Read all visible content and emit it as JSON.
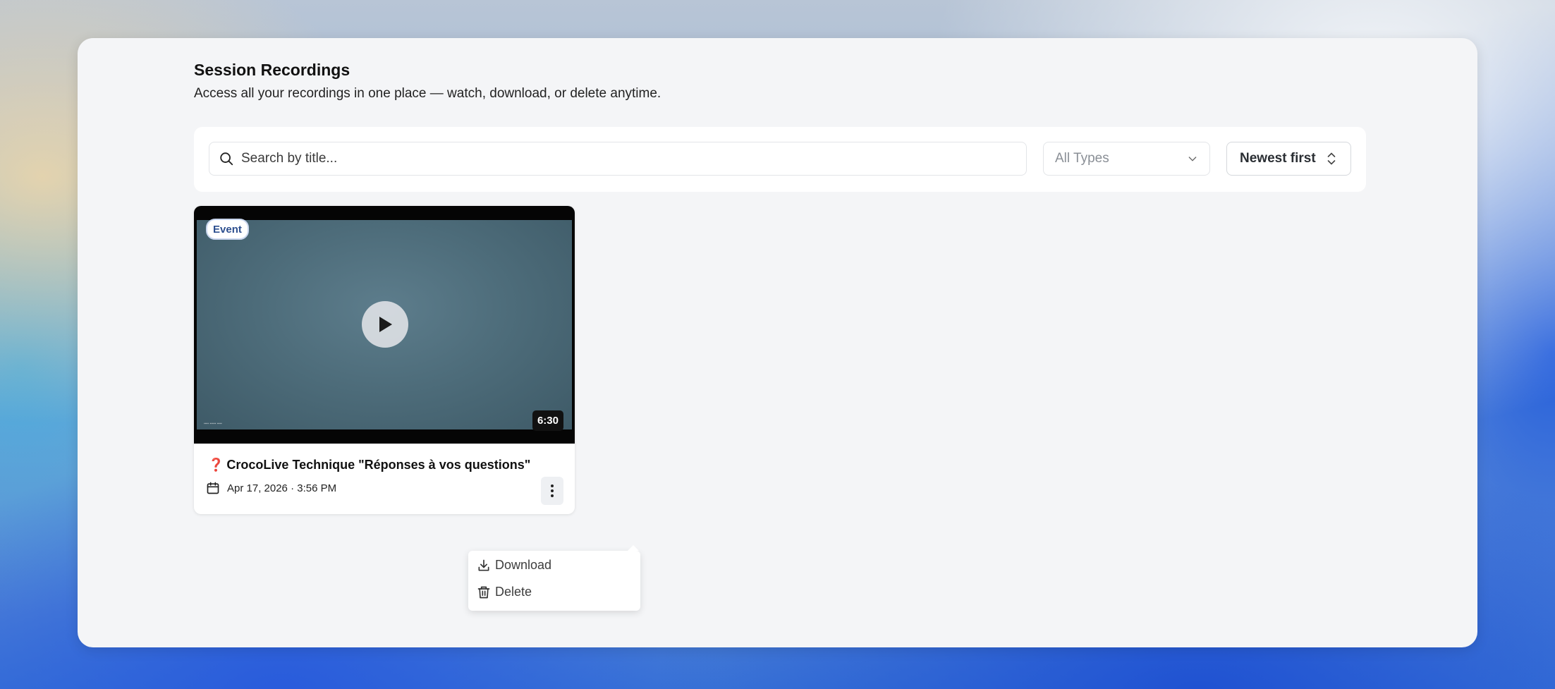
{
  "page": {
    "title": "Session Recordings",
    "subtitle": "Access all your recordings in one place — watch, download, or delete anytime."
  },
  "filters": {
    "search_placeholder": "Search by title...",
    "search_value": "",
    "type_selected": "All Types",
    "sort_label": "Newest first"
  },
  "recordings": [
    {
      "badge": "Event",
      "title": "CrocoLive Technique \"Réponses à vos questions\"",
      "title_prefix_icon": "❓",
      "date": "Apr 17, 2026 · 3:56 PM",
      "duration": "6:30"
    }
  ],
  "context_menu": {
    "download_label": "Download",
    "delete_label": "Delete"
  },
  "colors": {
    "panel_bg": "#f4f5f7",
    "badge_text": "#2d4f8f",
    "thumbnail_tint": "#4e6d7b"
  }
}
